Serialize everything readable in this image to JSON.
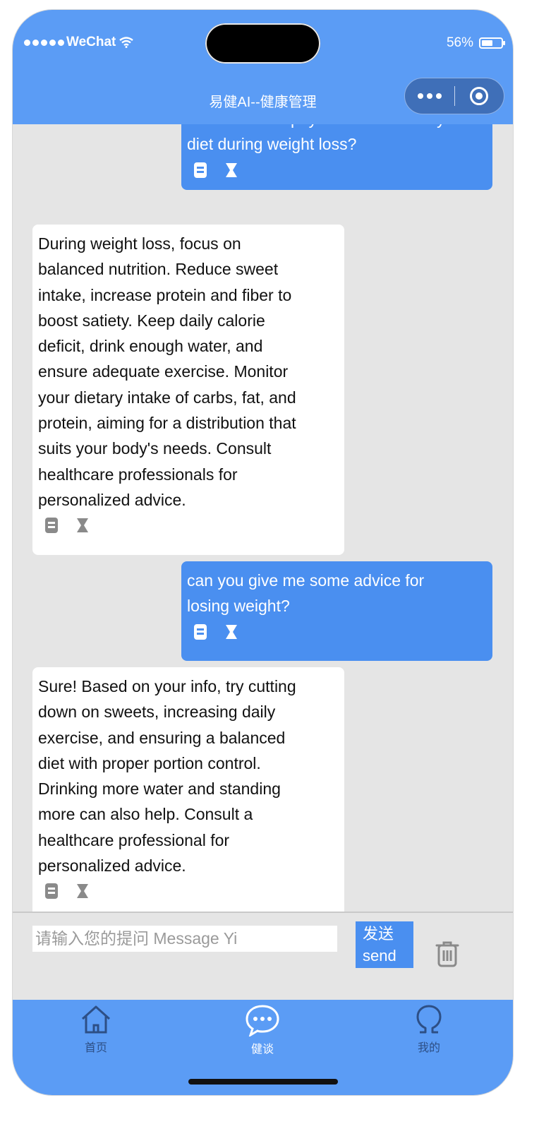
{
  "status_bar": {
    "carrier": "WeChat",
    "battery": "56%",
    "battery_level": 0.56
  },
  "nav": {
    "title": "易健AI--健康管理",
    "more_icon": "more-dots-icon",
    "close_icon": "target-circle-icon"
  },
  "messages": [
    {
      "role": "user",
      "lines": [
        "What should I pay attention to in my",
        "diet during weight loss?"
      ]
    },
    {
      "role": "assistant",
      "lines": [
        "During weight loss, focus on",
        "balanced nutrition. Reduce sweet",
        "intake, increase protein and fiber to",
        "boost satiety. Keep daily calorie",
        "deficit, drink enough water, and",
        "ensure adequate exercise. Monitor",
        "your dietary intake of carbs, fat, and",
        "protein, aiming for a distribution that",
        "suits your body's needs. Consult",
        "healthcare professionals for",
        "personalized advice."
      ]
    },
    {
      "role": "user",
      "lines": [
        "can you give me some advice for",
        "losing weight?"
      ]
    },
    {
      "role": "assistant",
      "lines": [
        "Sure! Based on your info, try cutting",
        "down on sweets, increasing daily",
        "exercise, and ensuring a balanced",
        "diet with proper portion control.",
        "Drinking more water and standing",
        "more can also help. Consult a",
        "healthcare professional for",
        "personalized advice."
      ]
    }
  ],
  "input": {
    "placeholder": "请输入您的提问 Message Yi",
    "value": ""
  },
  "send_button": {
    "line1": "发送",
    "line2": "send"
  },
  "tabs": [
    {
      "label": "首页",
      "icon": "home-icon",
      "active": false
    },
    {
      "label": "健谈",
      "icon": "chat-bubble-icon",
      "active": true
    },
    {
      "label": "我的",
      "icon": "profile-icon",
      "active": false
    }
  ],
  "colors": {
    "brand": "#5b9cf5",
    "user_bubble": "#4a8ff0",
    "background": "#e5e5e5"
  }
}
